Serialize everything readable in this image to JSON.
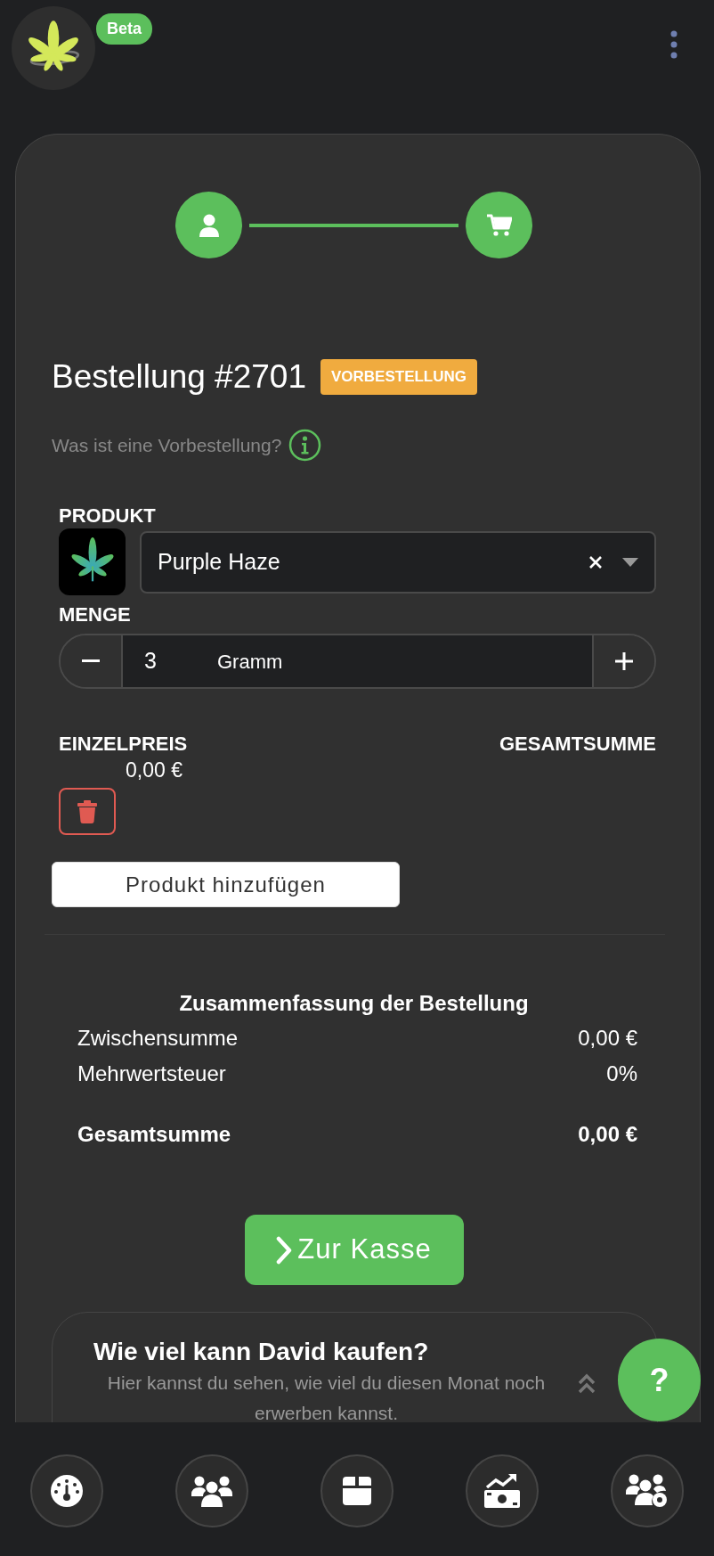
{
  "header": {
    "badge": "Beta"
  },
  "stepper": {
    "steps": [
      {
        "kind": "user"
      },
      {
        "kind": "cart"
      }
    ]
  },
  "order": {
    "title": "Bestellung #2701",
    "badge": "VORBESTELLUNG",
    "info_link": "Was ist eine Vorbestellung?"
  },
  "product": {
    "label": "PRODUKT",
    "value": "Purple Haze"
  },
  "quantity": {
    "label": "MENGE",
    "value": "3",
    "unit": "Gramm"
  },
  "price": {
    "unit_label": "EINZELPREIS",
    "total_label": "GESAMTSUMME",
    "unit_price": "0,00 €"
  },
  "add_button": "Produkt hinzufügen",
  "summary": {
    "title": "Zusammenfassung der Bestellung",
    "rows": [
      {
        "kind": "line",
        "label": "Zwischensumme",
        "value": "0,00 €"
      },
      {
        "kind": "line",
        "label": "Mehrwertsteuer",
        "value": "0%"
      },
      {
        "kind": "total",
        "label": "Gesamtsumme",
        "value": "0,00 €"
      }
    ]
  },
  "checkout_button": "Zur Kasse",
  "limit_card": {
    "title": "Wie viel kann David kaufen?",
    "text": "Hier kannst du sehen, wie viel du diesen Monat noch erwerben kannst."
  },
  "help_button": "?",
  "bottom_nav": [
    {
      "kind": "dashboard"
    },
    {
      "kind": "customers"
    },
    {
      "kind": "products"
    },
    {
      "kind": "finance"
    },
    {
      "kind": "staff"
    }
  ]
}
